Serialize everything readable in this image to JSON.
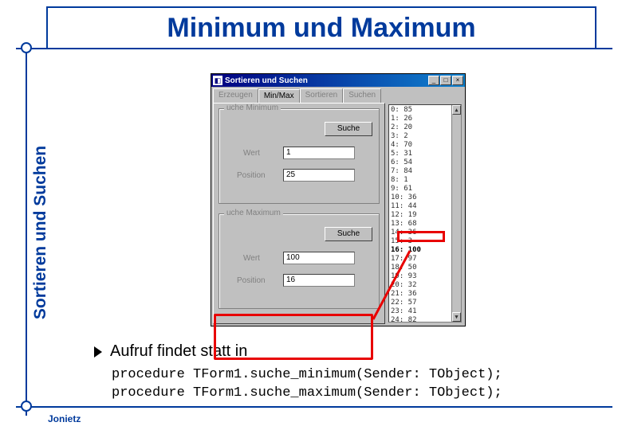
{
  "slide": {
    "title": "Minimum und Maximum",
    "sidebar_label": "Sortieren und Suchen",
    "bullet": "Aufruf findet statt in",
    "code_line1": "procedure TForm1.suche_minimum(Sender: TObject);",
    "code_line2": "procedure TForm1.suche_maximum(Sender: TObject);",
    "footer": "Jonietz"
  },
  "window": {
    "title": "Sortieren und Suchen",
    "tabs": [
      "Erzeugen",
      "Min/Max",
      "Sortieren",
      "Suchen"
    ],
    "group_min": {
      "title": "uche Minimum",
      "button": "Suche",
      "wert_label": "Wert",
      "wert_value": "1",
      "pos_label": "Position",
      "pos_value": "25"
    },
    "group_max": {
      "title": "uche Maximum",
      "button": "Suche",
      "wert_label": "Wert",
      "wert_value": "100",
      "pos_label": "Position",
      "pos_value": "16"
    },
    "list": [
      "0: 85",
      "1: 26",
      "2: 20",
      "3: 2",
      "4: 70",
      "5: 31",
      "6: 54",
      "7: 84",
      "8: 1",
      "9: 61",
      "10: 36",
      "11: 44",
      "12: 19",
      "13: 68",
      "14: 36",
      "15: 3",
      "16: 100",
      "17: 97",
      "18: 50",
      "19: 93",
      "20: 32",
      "21: 36",
      "22: 57",
      "23: 41",
      "24: 82"
    ]
  }
}
